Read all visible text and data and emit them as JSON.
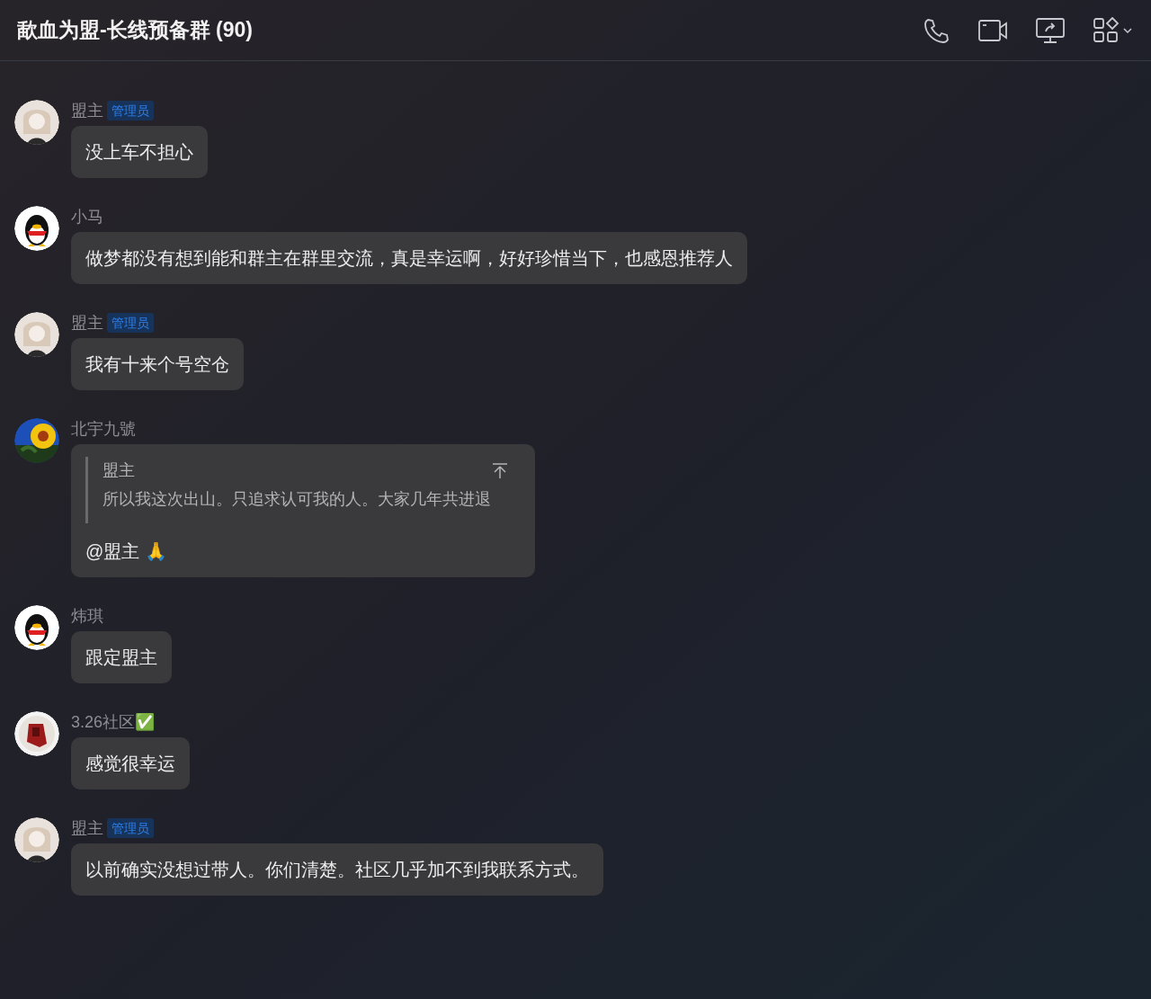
{
  "header": {
    "title": "歃血为盟-长线预备群 (90)"
  },
  "messages": [
    {
      "sender": "盟主",
      "badge": "管理员",
      "avatar": {
        "kind": "figure"
      },
      "text": "没上车不担心"
    },
    {
      "sender": "小马",
      "avatar": {
        "kind": "penguin"
      },
      "text": "做梦都没有想到能和群主在群里交流，真是幸运啊，好好珍惜当下，也感恩推荐人"
    },
    {
      "sender": "盟主",
      "badge": "管理员",
      "avatar": {
        "kind": "figure"
      },
      "text": "我有十来个号空仓"
    },
    {
      "sender": "北宇九號",
      "quote": {
        "sender": "盟主",
        "text": "所以我这次出山。只追求认可我的人。大家几年共进退"
      },
      "text": "@盟主 🙏"
    },
    {
      "sender": "炜琪",
      "avatar": {
        "kind": "penguin"
      },
      "text": "跟定盟主"
    },
    {
      "sender": "3.26社区✅",
      "avatar": {
        "kind": "photo-red"
      },
      "text": "感觉很幸运"
    },
    {
      "sender": "盟主",
      "badge": "管理员",
      "avatar": {
        "kind": "figure"
      },
      "text": "以前确实没想过带人。你们清楚。社区几乎加不到我联系方式。"
    }
  ]
}
